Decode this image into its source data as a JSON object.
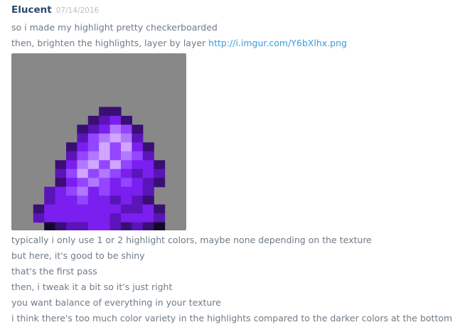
{
  "message": {
    "author": "Elucent",
    "timestamp": "07/14/2016",
    "lines_before": [
      "so i made my highlight pretty checkerboarded",
      "then, brighten the highlights, layer by layer "
    ],
    "link_text": "http://i.imgur.com/Y6bXlhx.png",
    "attachment": {
      "background": "#888888",
      "icon": "purple-gem-pixel-art"
    },
    "lines_after": [
      "typically i only use 1 or 2 highlight colors, maybe none depending on the texture",
      "but here, it's good to be shiny",
      "that's the first pass",
      "then, i tweak it a bit so it's just right",
      "you want balance of everything in your texture",
      "i think there's too much color variety in the highlights compared to the darker colors at the bottom"
    ]
  },
  "colors": {
    "username": "#2a4a6b",
    "link": "#3a9bd9",
    "text": "#6f7b87",
    "timestamp": "#b9bec4"
  }
}
